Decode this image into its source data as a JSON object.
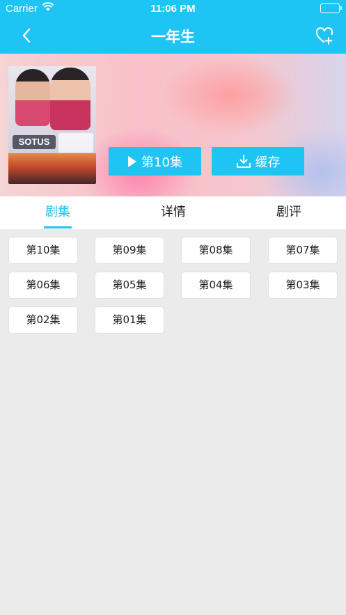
{
  "status_bar": {
    "carrier": "Carrier",
    "time": "11:06 PM"
  },
  "nav": {
    "title": "一年生",
    "back_icon": "chevron-left-icon",
    "favorite_icon": "heart-plus-icon"
  },
  "actions": {
    "play_label": "第10集",
    "cache_label": "缓存"
  },
  "tabs": [
    {
      "label": "剧集",
      "active": true
    },
    {
      "label": "详情",
      "active": false
    },
    {
      "label": "剧评",
      "active": false
    }
  ],
  "episodes": [
    "第10集",
    "第09集",
    "第08集",
    "第07集",
    "第06集",
    "第05集",
    "第04集",
    "第03集",
    "第02集",
    "第01集"
  ],
  "poster": {
    "logo_text": "SOTUS"
  },
  "colors": {
    "accent": "#1ec4f3",
    "background": "#ebebeb"
  }
}
